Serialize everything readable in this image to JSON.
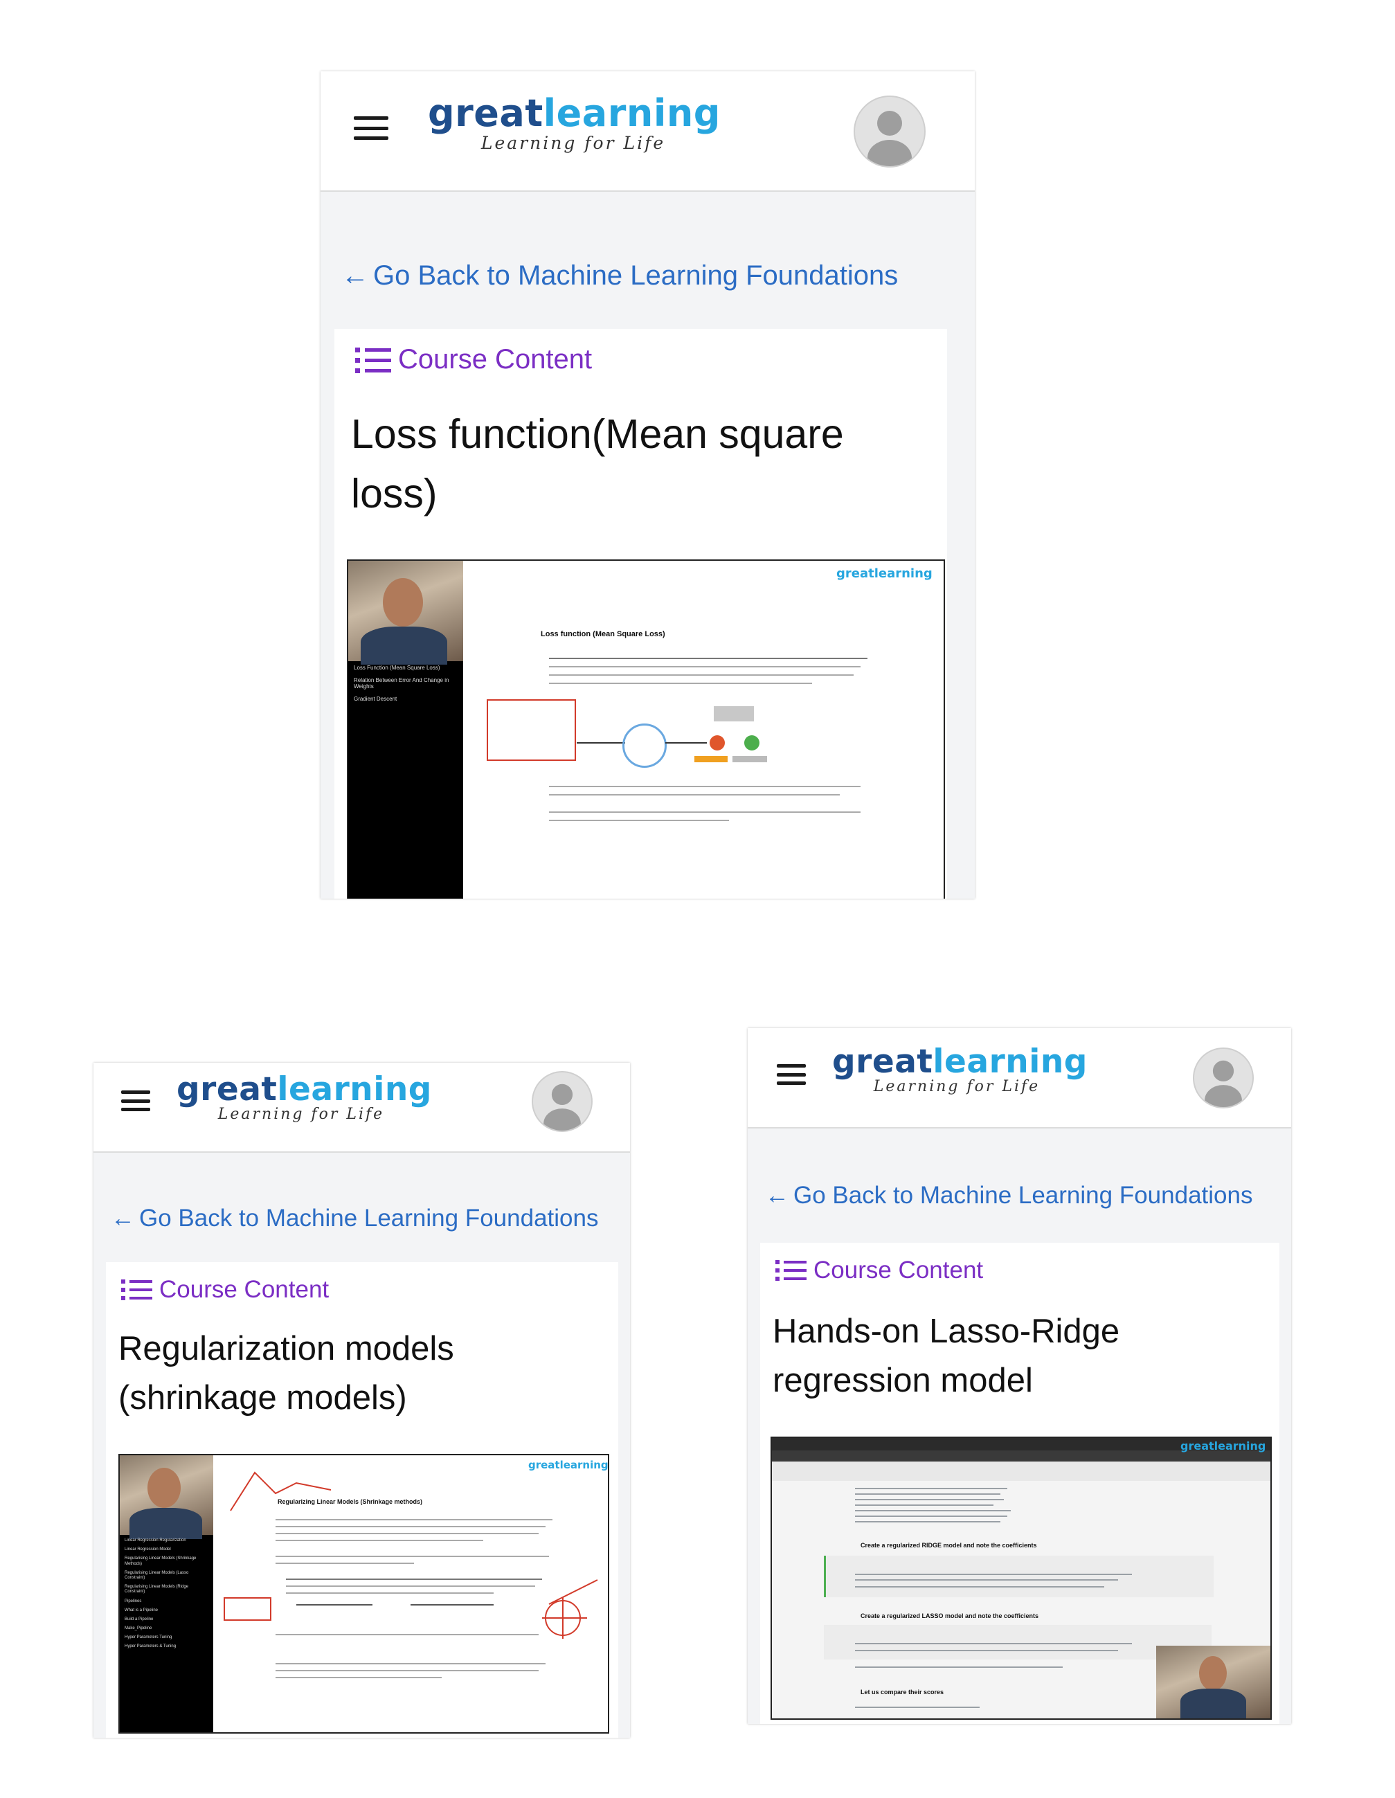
{
  "brand": {
    "logo_great": "great",
    "logo_learning": "learning",
    "tagline": "Learning for Life",
    "color_primary": "#1f4e8c",
    "color_accent": "#27a6df"
  },
  "nav": {
    "menu_icon": "hamburger-menu-icon",
    "avatar_icon": "user-avatar-icon"
  },
  "screens": [
    {
      "back_arrow": "←",
      "back_label": "Go Back to Machine Learning Foundations",
      "course_content_label": "Course Content",
      "lesson_title": "Loss function(Mean square loss)",
      "video": {
        "logo": "greatlearning",
        "slide_heading": "Loss function (Mean Square Loss)",
        "playlist": [
          "Loss Function (Mean Square Loss)",
          "Relation Between Error And Change in Weights",
          "Gradient Descent"
        ]
      }
    },
    {
      "back_arrow": "←",
      "back_label": "Go Back to Machine Learning Foundations",
      "course_content_label": "Course Content",
      "lesson_title": "Regularization models (shrinkage models)",
      "video": {
        "logo": "greatlearning",
        "slide_heading": "Regularizing Linear Models (Shrinkage methods)",
        "playlist": [
          "Linear Regression Regularization",
          "Linear Regression Model",
          "Regularising Linear Models (Shrinkage Methods)",
          "Regularising Linear Models (Lasso Constraint)",
          "Regularising Linear Models (Ridge Constraint)",
          "Pipelines",
          "What is a Pipeline",
          "Build a Pipeline",
          "Make_Pipeline",
          "Hyper Parameters Tuning",
          "Hyper Parameters & Tuning"
        ]
      }
    },
    {
      "back_arrow": "←",
      "back_label": "Go Back to Machine Learning Foundations",
      "course_content_label": "Course Content",
      "lesson_title": "Hands-on Lasso-Ridge regression model",
      "video": {
        "logo": "greatlearning",
        "section_ridge": "Create a regularized RIDGE model and note the coefficients",
        "section_lasso": "Create a regularized LASSO model and note the coefficients",
        "section_compare": "Let us compare their scores"
      }
    }
  ]
}
